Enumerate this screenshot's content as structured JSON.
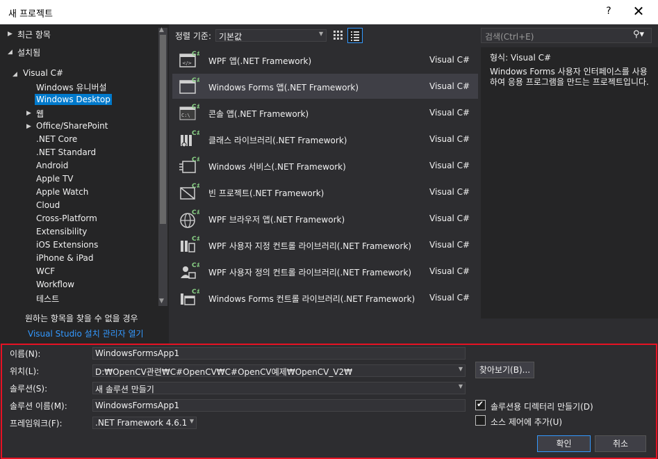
{
  "window": {
    "title": "새 프로젝트",
    "help": "?",
    "close": "✕"
  },
  "tree": {
    "items": [
      {
        "label": "최근 항목",
        "arrow": "▶"
      },
      {
        "label": "설치됨",
        "arrow": "◢"
      },
      {
        "label": "Visual C#",
        "arrow": "◢"
      },
      {
        "label": "Windows 유니버설"
      },
      {
        "label": "Windows Desktop",
        "selected": true
      },
      {
        "label": "웹",
        "arrow": "▶"
      },
      {
        "label": "Office/SharePoint",
        "arrow": "▶"
      },
      {
        "label": ".NET Core"
      },
      {
        "label": ".NET Standard"
      },
      {
        "label": "Android"
      },
      {
        "label": "Apple TV"
      },
      {
        "label": "Apple Watch"
      },
      {
        "label": "Cloud"
      },
      {
        "label": "Cross-Platform"
      },
      {
        "label": "Extensibility"
      },
      {
        "label": "iOS Extensions"
      },
      {
        "label": "iPhone & iPad"
      },
      {
        "label": "WCF"
      },
      {
        "label": "Workflow"
      },
      {
        "label": "테스트"
      }
    ],
    "not_found": "원하는 항목을 찾을 수 없을 경우",
    "installer_link": "Visual Studio 설치 관리자 열기"
  },
  "sort": {
    "label": "정렬 기준:",
    "value": "기본값"
  },
  "templates": [
    {
      "name": "WPF 앱(.NET Framework)",
      "lang": "Visual C#"
    },
    {
      "name": "Windows Forms 앱(.NET Framework)",
      "lang": "Visual C#",
      "selected": true
    },
    {
      "name": "콘솔 앱(.NET Framework)",
      "lang": "Visual C#"
    },
    {
      "name": "클래스 라이브러리(.NET Framework)",
      "lang": "Visual C#"
    },
    {
      "name": "Windows 서비스(.NET Framework)",
      "lang": "Visual C#"
    },
    {
      "name": "빈 프로젝트(.NET Framework)",
      "lang": "Visual C#"
    },
    {
      "name": "WPF 브라우저 앱(.NET Framework)",
      "lang": "Visual C#"
    },
    {
      "name": "WPF 사용자 지정 컨트롤 라이브러리(.NET Framework)",
      "lang": "Visual C#"
    },
    {
      "name": "WPF 사용자 정의 컨트롤 라이브러리(.NET Framework)",
      "lang": "Visual C#"
    },
    {
      "name": "Windows Forms 컨트롤 라이브러리(.NET Framework)",
      "lang": "Visual C#"
    }
  ],
  "search": {
    "placeholder": "검색(Ctrl+E)"
  },
  "description": {
    "type_label": "형식:",
    "type_value": "Visual C#",
    "text": "Windows Forms 사용자 인터페이스를 사용하여 응용 프로그램을 만드는 프로젝트입니다."
  },
  "form": {
    "name_label": "이름(N):",
    "name_value": "WindowsFormsApp1",
    "location_label": "위치(L):",
    "location_value": "D:₩OpenCV관련₩C#OpenCV₩C#OpenCV예제₩OpenCV_V2₩",
    "browse": "찾아보기(B)...",
    "solution_label": "솔루션(S):",
    "solution_value": "새 솔루션 만들기",
    "solution_name_label": "솔루션 이름(M):",
    "solution_name_value": "WindowsFormsApp1",
    "framework_label": "프레임워크(F):",
    "framework_value": ".NET Framework 4.6.1",
    "create_dir_label": "솔루션용 디렉터리 만들기(D)",
    "create_dir_checked": true,
    "source_control_label": "소스 제어에 추가(U)",
    "source_control_checked": false,
    "ok": "확인",
    "cancel": "취소"
  },
  "colors": {
    "accent": "#007acc",
    "highlight_border": "#e81123",
    "background": "#2d2d30"
  }
}
